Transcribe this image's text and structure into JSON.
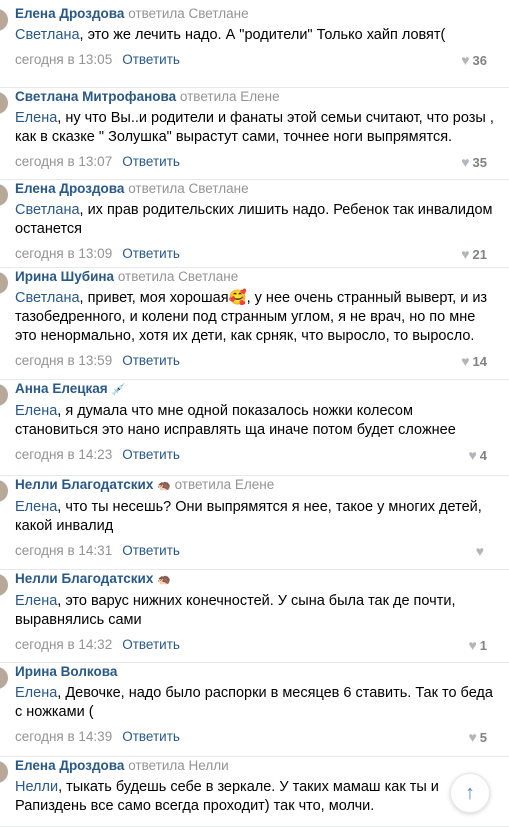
{
  "comments": [
    {
      "author": "Елена Дроздова",
      "author_emoji": "",
      "replied": "ответила Светлане",
      "lines": [
        {
          "mention": "Светлана",
          "text": ", это же лечить надо. А \"родители\" Только хайп ловят("
        }
      ],
      "date": "сегодня в 13:05",
      "reply": "Ответить",
      "likes": "36"
    },
    {
      "author": "Светлана Митрофанова",
      "author_emoji": "",
      "replied": "ответила Елене",
      "lines": [
        {
          "mention": "Елена",
          "text": ", ну что Вы..и родители и фанаты этой семьи считают, что розы ,"
        },
        {
          "mention": "",
          "text": "как в сказке \" Золушка\" вырастут сами, точнее ноги выпрямятся."
        }
      ],
      "date": "сегодня в 13:07",
      "reply": "Ответить",
      "likes": "35"
    },
    {
      "author": "Елена Дроздова",
      "author_emoji": "",
      "replied": "ответила Светлане",
      "lines": [
        {
          "mention": "Светлана",
          "text": ", их прав родительских лишить надо. Ребенок так инвалидом"
        },
        {
          "mention": "",
          "text": "останется"
        }
      ],
      "date": "сегодня в 13:09",
      "reply": "Ответить",
      "likes": "21"
    },
    {
      "author": "Ирина Шубина",
      "author_emoji": "",
      "replied": "ответила Светлане",
      "lines": [
        {
          "mention": "Светлана",
          "text": ", привет, моя хорошая🥰, у нее очень странный выверт, и из"
        },
        {
          "mention": "",
          "text": "тазобедренного, и колени под странным углом, я не врач, но по мне"
        },
        {
          "mention": "",
          "text": "это ненормально, хотя их дети, как срняк, что выросло, то выросло."
        }
      ],
      "date": "сегодня в 13:59",
      "reply": "Ответить",
      "likes": "14"
    },
    {
      "author": "Анна Елецкая",
      "author_emoji": "💉",
      "replied": "",
      "lines": [
        {
          "mention": "Елена",
          "text": ", я думала что мне одной показалось ножки колесом"
        },
        {
          "mention": "",
          "text": "становиться это нано исправлять ща иначе потом будет сложнее"
        }
      ],
      "date": "сегодня в 14:23",
      "reply": "Ответить",
      "likes": "4"
    },
    {
      "author": "Нелли Благодатских",
      "author_emoji": "🦔",
      "replied": "ответила Елене",
      "lines": [
        {
          "mention": "Елена",
          "text": ", что ты несешь? Они выпрямятся я нее, такое у многих детей,"
        },
        {
          "mention": "",
          "text": "какой инвалид"
        }
      ],
      "date": "сегодня в 14:31",
      "reply": "Ответить",
      "likes": ""
    },
    {
      "author": "Нелли Благодатских",
      "author_emoji": "🦔",
      "replied": "",
      "lines": [
        {
          "mention": "Елена",
          "text": ", это варус нижних конечностей. У сына была так де почти,"
        },
        {
          "mention": "",
          "text": "выравнялись сами"
        }
      ],
      "date": "сегодня в 14:32",
      "reply": "Ответить",
      "likes": "1"
    },
    {
      "author": "Ирина Волкова",
      "author_emoji": "",
      "replied": "",
      "lines": [
        {
          "mention": "Елена",
          "text": ", Девочке, надо было распорки в месяцев 6 ставить. Так то беда"
        },
        {
          "mention": "",
          "text": "с ножками ("
        }
      ],
      "date": "сегодня в 14:39",
      "reply": "Ответить",
      "likes": "5"
    },
    {
      "author": "Елена Дроздова",
      "author_emoji": "",
      "replied": "ответила Нелли",
      "lines": [
        {
          "mention": "Нелли",
          "text": ", тыкать будешь себе в зеркале. У таких мамаш как ты и"
        },
        {
          "mention": "",
          "text": "Рапиздень все само всегда проходит) так что, молчи."
        }
      ],
      "date": "",
      "reply": "",
      "likes": ""
    }
  ],
  "scroll_top_icon": "arrow-up-icon",
  "colors": {
    "link": "#2a5885",
    "muted": "#939393",
    "divider": "#e7e8ec"
  }
}
